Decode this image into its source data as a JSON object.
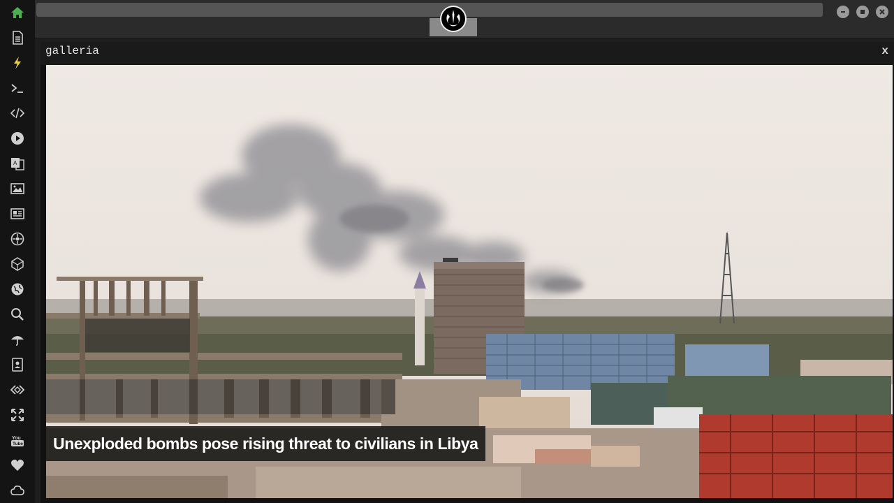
{
  "window": {
    "title": "galleria",
    "close_label": "x"
  },
  "caption": "Unexploded bombs pose rising threat to civilians in Libya",
  "sidebar": {
    "icons": [
      "home-icon",
      "document-icon",
      "lightning-icon",
      "terminal-icon",
      "code-icon",
      "play-icon",
      "translate-icon",
      "image-icon",
      "news-icon",
      "atom-icon",
      "cube-icon",
      "globe-icon",
      "search-icon",
      "umbrella-icon",
      "contact-icon",
      "dev-icon",
      "expand-icon",
      "youtube-icon",
      "heart-icon",
      "cloud-icon"
    ],
    "active_color": "#4caf50"
  },
  "colors": {
    "accent": "#4caf50",
    "background": "#1e1e1e",
    "sidebar": "#141414"
  }
}
